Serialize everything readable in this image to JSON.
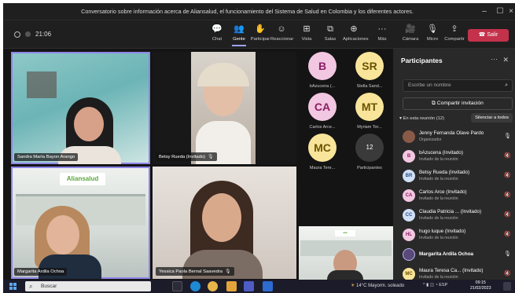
{
  "window": {
    "title": "Conversatorio sobre información acerca de Aliansalud,  el funcionamiento del Sistema de Salud en Colombia y los diferentes actores."
  },
  "toolbar": {
    "timer": "21:06",
    "items": [
      {
        "label": "Chat",
        "icon": "chat-icon"
      },
      {
        "label": "Gente",
        "icon": "people-icon"
      },
      {
        "label": "Participar",
        "icon": "raise-hand-icon"
      },
      {
        "label": "Reaccionar",
        "icon": "smile-icon"
      },
      {
        "label": "Vista",
        "icon": "grid-icon"
      },
      {
        "label": "Salas",
        "icon": "rooms-icon"
      },
      {
        "label": "Aplicaciones",
        "icon": "apps-icon"
      },
      {
        "label": "Más",
        "icon": "more-icon"
      },
      {
        "label": "Cámara",
        "icon": "camera-icon"
      },
      {
        "label": "Micro",
        "icon": "mic-icon"
      },
      {
        "label": "Compartir",
        "icon": "share-icon"
      }
    ],
    "leave_label": "Salir",
    "accent": "#c4314b"
  },
  "stage": {
    "tiles": [
      {
        "name": "Sandra María Bayon Arango"
      },
      {
        "name": "Betsy Rueda (Invitado)"
      },
      {
        "name": "Margarita Ardila Ochoa",
        "banner": "Aliansalud"
      },
      {
        "name": "Yessica Paola Bernal Saavedra"
      }
    ],
    "avatars": [
      {
        "initials": "B",
        "name": "bAzucena (..."
      },
      {
        "initials": "SR",
        "name": "Stella Sand..."
      },
      {
        "initials": "CA",
        "name": "Carlos Arce..."
      },
      {
        "initials": "MT",
        "name": "Myriam Tor..."
      },
      {
        "initials": "MC",
        "name": "Maura Tere..."
      },
      {
        "initials": "12",
        "name": "Participantes"
      }
    ]
  },
  "panel": {
    "title": "Participantes",
    "search_placeholder": "Escribe un nombre",
    "invite_label": "Compartir invitación",
    "section_label": "En esta reunión (12)",
    "mute_all": "Silenciar a todos",
    "people": [
      {
        "initials": "",
        "name": "Jenny Fernanda Olave Pardo",
        "role": "Organizador",
        "style": "photo"
      },
      {
        "initials": "B",
        "name": "bAzucena (Invitado)",
        "role": "Invitado de la reunión",
        "style": "pink"
      },
      {
        "initials": "BR",
        "name": "Betsy Rueda (Invitado)",
        "role": "Invitado de la reunión",
        "style": "blue"
      },
      {
        "initials": "CA",
        "name": "Carlos Arce (Invitado)",
        "role": "Invitado de la reunión",
        "style": "pink"
      },
      {
        "initials": "CC",
        "name": "Claudia Patricia ...  (Invitado)",
        "role": "Invitado de la reunión",
        "style": "blue"
      },
      {
        "initials": "HL",
        "name": "hugo luque (Invitado)",
        "role": "Invitado de la reunión",
        "style": "pink"
      },
      {
        "initials": "",
        "name": "Margarita Ardila Ochoa",
        "role": "",
        "style": "photo2"
      },
      {
        "initials": "MC",
        "name": "Maura Teresa Ca...  (Invitado)",
        "role": "Invitado de la reunión",
        "style": "yellow"
      }
    ]
  },
  "taskbar": {
    "search": "Buscar",
    "weather": "14°C  Mayorm. soleado",
    "lang": "ESP",
    "time": "09:15",
    "date": "21/02/2023"
  }
}
